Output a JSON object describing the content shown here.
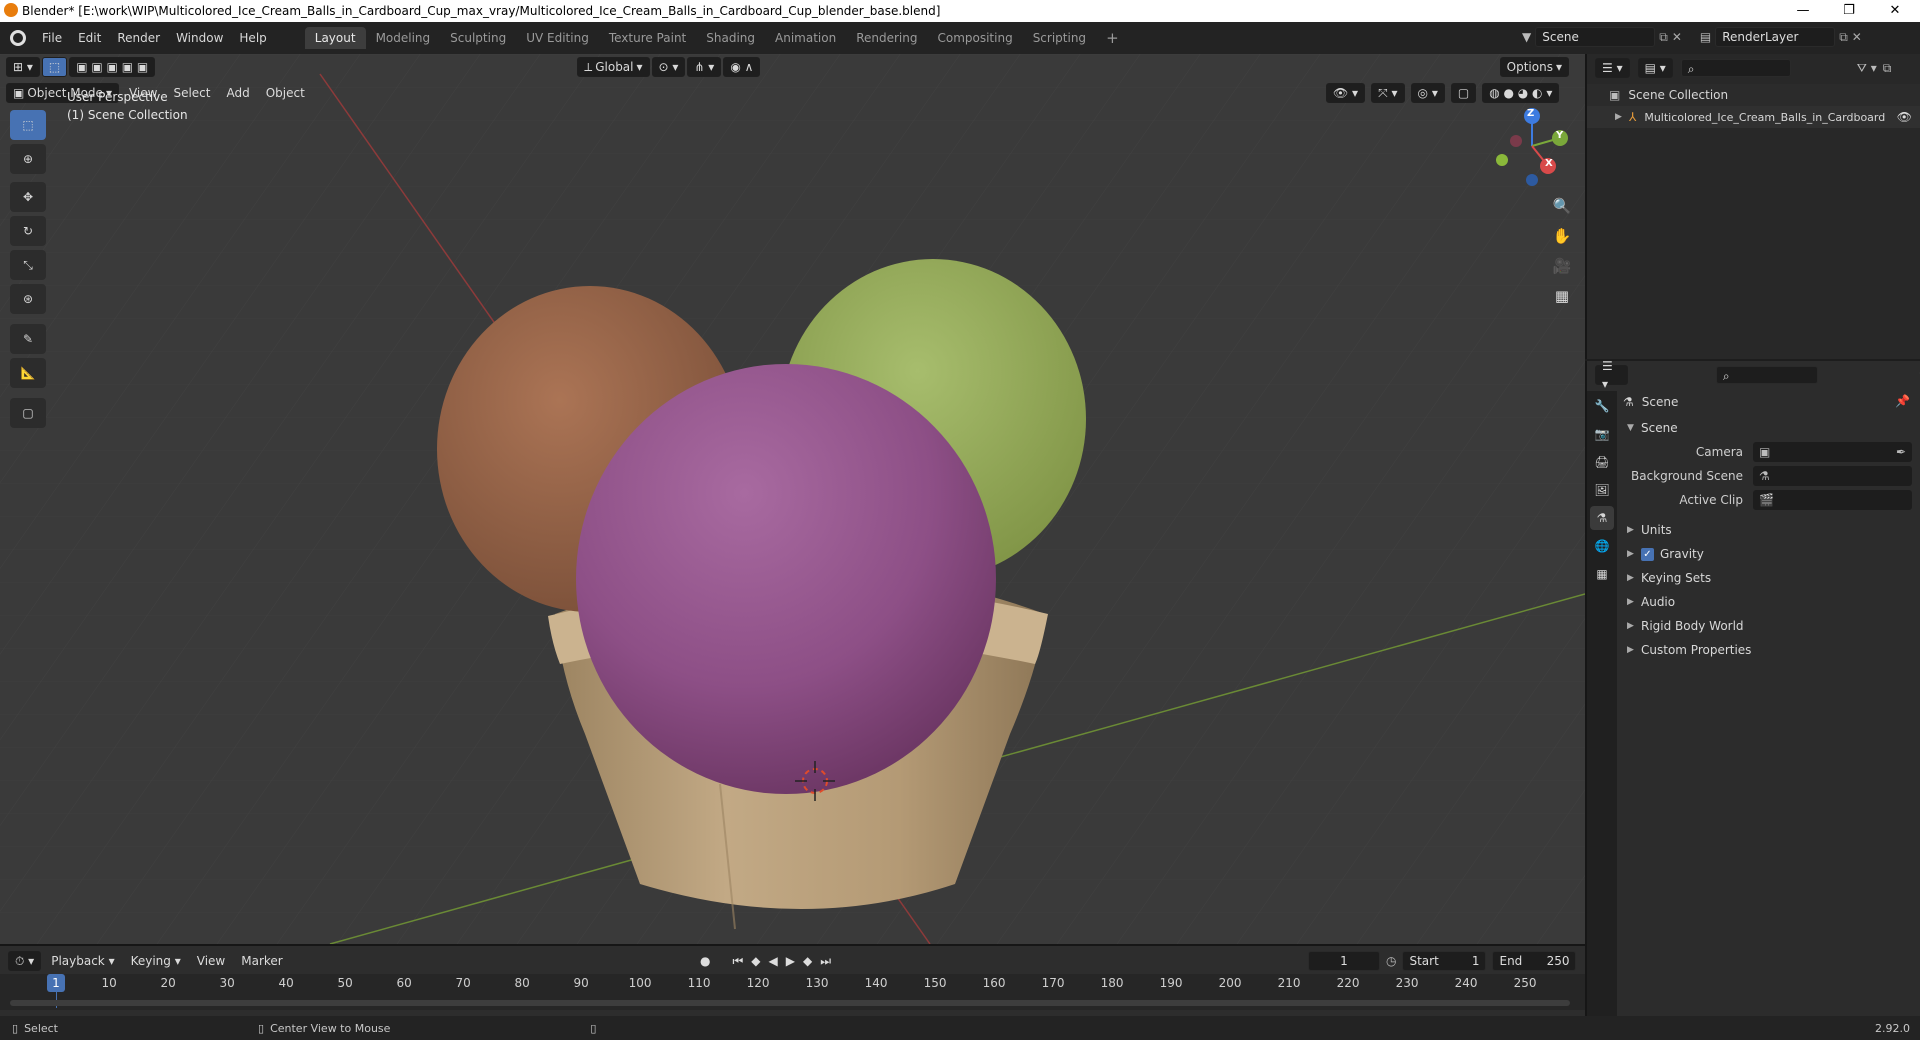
{
  "window": {
    "title": "Blender* [E:\\work\\WIP\\Multicolored_Ice_Cream_Balls_in_Cardboard_Cup_max_vray/Multicolored_Ice_Cream_Balls_in_Cardboard_Cup_blender_base.blend]",
    "minimize": "—",
    "maximize": "❐",
    "close": "✕"
  },
  "menu": [
    "File",
    "Edit",
    "Render",
    "Window",
    "Help"
  ],
  "workspaces": [
    "Layout",
    "Modeling",
    "Sculpting",
    "UV Editing",
    "Texture Paint",
    "Shading",
    "Animation",
    "Rendering",
    "Compositing",
    "Scripting"
  ],
  "active_workspace": "Layout",
  "add_workspace": "+",
  "scene_selector": {
    "value": "Scene"
  },
  "view_layer_selector": {
    "value": "RenderLayer"
  },
  "tool_header": {
    "orientation": "Global",
    "options": "Options"
  },
  "viewport_header": {
    "mode": "Object Mode",
    "menus": [
      "View",
      "Select",
      "Add",
      "Object"
    ]
  },
  "viewport": {
    "perspective": "User Perspective",
    "collection": "(1) Scene Collection",
    "gizmo": {
      "x": "X",
      "y": "Y",
      "z": "Z"
    }
  },
  "outliner": {
    "root": "Scene Collection",
    "items": [
      "Multicolored_Ice_Cream_Balls_in_Cardboard"
    ]
  },
  "properties": {
    "context": "Scene",
    "section": "Scene",
    "fields": [
      {
        "label": "Camera",
        "value": ""
      },
      {
        "label": "Background Scene",
        "value": ""
      },
      {
        "label": "Active Clip",
        "value": ""
      }
    ],
    "panels": [
      "Units",
      "Gravity",
      "Keying Sets",
      "Audio",
      "Rigid Body World",
      "Custom Properties"
    ],
    "gravity_checked": true
  },
  "timeline": {
    "menus": [
      "Playback",
      "Keying",
      "View",
      "Marker"
    ],
    "current_frame": "1",
    "start_label": "Start",
    "start": "1",
    "end_label": "End",
    "end": "250",
    "ruler": [
      "10",
      "20",
      "30",
      "40",
      "50",
      "60",
      "70",
      "80",
      "90",
      "100",
      "110",
      "120",
      "130",
      "140",
      "150",
      "160",
      "170",
      "180",
      "190",
      "200",
      "210",
      "220",
      "230",
      "240",
      "250"
    ],
    "playhead": "1"
  },
  "statusbar": {
    "left": "Select",
    "middle": "Center View to Mouse",
    "version": "2.92.0"
  }
}
